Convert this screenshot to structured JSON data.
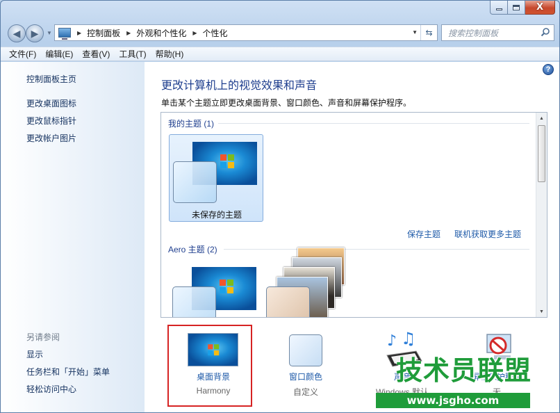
{
  "window": {
    "minimize_glyph": "",
    "close_glyph": "X"
  },
  "nav": {
    "back_glyph": "◀",
    "forward_glyph": "▶",
    "breadcrumbs": [
      "控制面板",
      "外观和个性化",
      "个性化"
    ],
    "search_placeholder": "搜索控制面板"
  },
  "menubar": {
    "items": [
      "文件(F)",
      "编辑(E)",
      "查看(V)",
      "工具(T)",
      "帮助(H)"
    ]
  },
  "sidebar": {
    "home_link": "控制面板主页",
    "links": [
      "更改桌面图标",
      "更改鼠标指针",
      "更改帐户图片"
    ],
    "see_also_heading": "另请参阅",
    "see_also_links": [
      "显示",
      "任务栏和「开始」菜单",
      "轻松访问中心"
    ]
  },
  "main": {
    "help_glyph": "?",
    "title": "更改计算机上的视觉效果和声音",
    "description": "单击某个主题立即更改桌面背景、窗口颜色、声音和屏幕保护程序。",
    "my_themes_label": "我的主题 (1)",
    "unsaved_theme_label": "未保存的主题",
    "save_theme_link": "保存主题",
    "get_more_themes_link": "联机获取更多主题",
    "aero_themes_label": "Aero 主题 (2)"
  },
  "settings": {
    "background": {
      "label": "桌面背景",
      "value": "Harmony"
    },
    "color": {
      "label": "窗口颜色",
      "value": "自定义"
    },
    "sound": {
      "label": "声音",
      "value": "Windows 默认"
    },
    "screensaver": {
      "label": "屏幕保护程序",
      "value": "无"
    }
  },
  "watermark": {
    "text": "技术员联盟",
    "url": "www.jsgho.com"
  },
  "colors": {
    "link": "#1e5aa8",
    "title": "#1e3e8e",
    "highlight_border": "#d62323",
    "watermark": "#1f9c3a"
  }
}
